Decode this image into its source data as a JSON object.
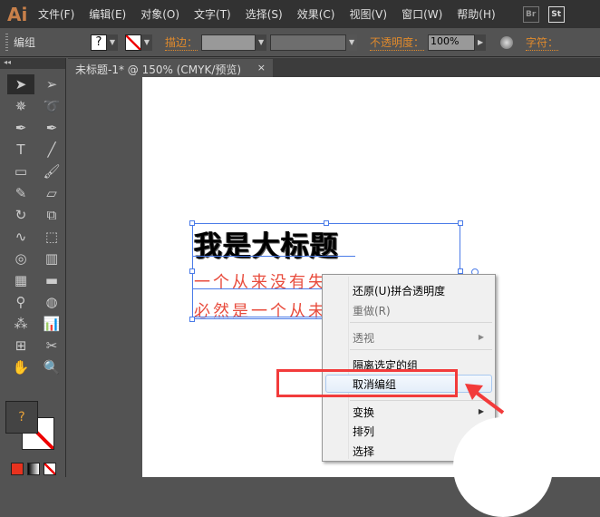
{
  "app": {
    "logo": "Ai",
    "menu": [
      "文件(F)",
      "编辑(E)",
      "对象(O)",
      "文字(T)",
      "选择(S)",
      "效果(C)",
      "视图(V)",
      "窗口(W)",
      "帮助(H)"
    ],
    "app_icons": [
      "Br",
      "St"
    ]
  },
  "control": {
    "selection_label": "编组",
    "fill_swatch": "?",
    "stroke_label": "描边：",
    "opacity_label": "不透明度：",
    "opacity_value": "100%",
    "char_label": "字符："
  },
  "document_tab": {
    "title": "未标题-1* @ 150% (CMYK/预览)",
    "close": "×"
  },
  "toolbar": {
    "collapse": "◂◂",
    "fill_unknown": "?",
    "tools": [
      "selection",
      "direct-selection",
      "magic-wand",
      "lasso",
      "pen",
      "curvature",
      "type",
      "line",
      "rectangle",
      "paintbrush",
      "pencil",
      "eraser",
      "rotate",
      "scale",
      "warp",
      "free-transform",
      "shape-builder",
      "graph-column",
      "mesh",
      "gradient",
      "eyedropper",
      "blend",
      "symbol-sprayer",
      "column-graph",
      "artboard",
      "slice",
      "hand",
      "zoom"
    ]
  },
  "canvas": {
    "title": "我是大标题",
    "line1": "一个从来没有失",
    "line2": "必然是一个从未"
  },
  "context_menu": {
    "items": [
      {
        "label": "还原(U)拼合透明度",
        "disabled": false
      },
      {
        "label": "重做(R)",
        "disabled": true
      },
      {
        "label": "透视",
        "disabled": true,
        "submenu": true
      },
      {
        "label": "隔离选定的组",
        "disabled": false
      },
      {
        "label": "取消编组",
        "disabled": false,
        "highlighted": true
      },
      {
        "label": "变换",
        "disabled": false,
        "submenu": true
      },
      {
        "label": "排列",
        "disabled": false
      },
      {
        "label": "选择",
        "disabled": false
      }
    ]
  },
  "colors": {
    "accent": "#e08a2c",
    "annotation": "#f23b3b",
    "selection": "#4a7be8"
  }
}
